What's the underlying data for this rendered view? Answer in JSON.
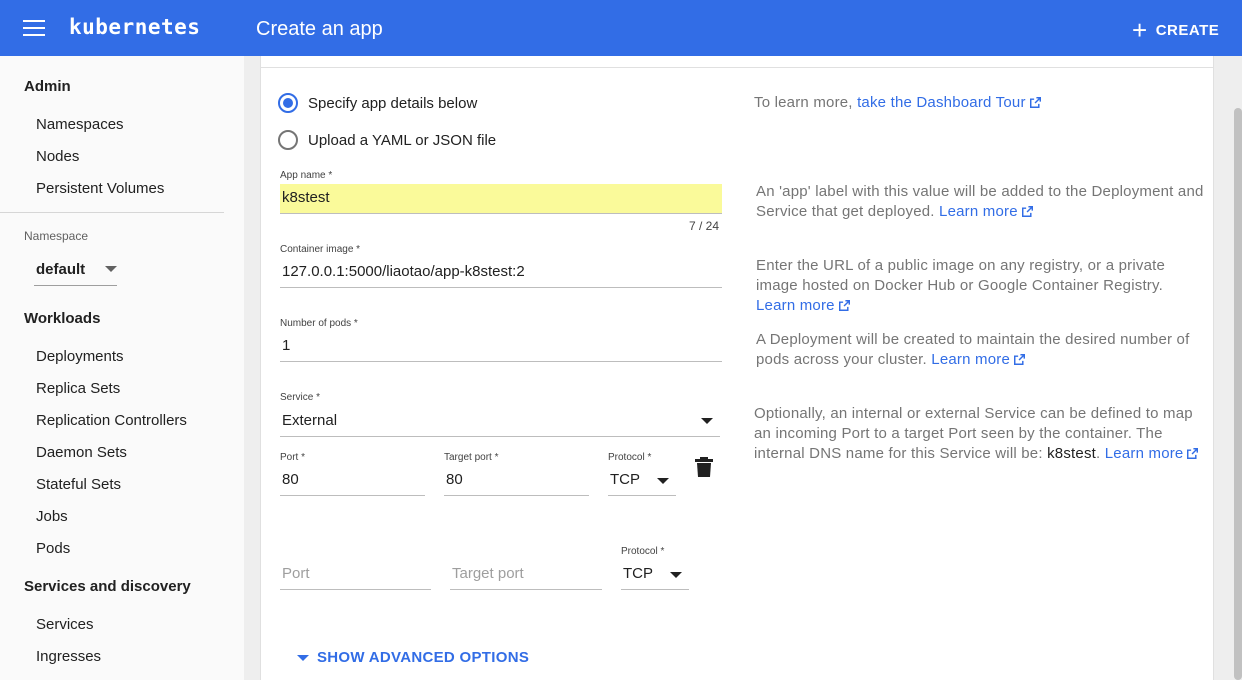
{
  "header": {
    "brand": "kubernetes",
    "title": "Create an app",
    "create_label": "CREATE"
  },
  "sidebar": {
    "admin_heading": "Admin",
    "admin_items": [
      "Namespaces",
      "Nodes",
      "Persistent Volumes"
    ],
    "namespace_label": "Namespace",
    "namespace_value": "default",
    "workloads_heading": "Workloads",
    "workload_items": [
      "Deployments",
      "Replica Sets",
      "Replication Controllers",
      "Daemon Sets",
      "Stateful Sets",
      "Jobs",
      "Pods"
    ],
    "services_heading": "Services and discovery",
    "service_items": [
      "Services",
      "Ingresses"
    ]
  },
  "form": {
    "radio_specify": "Specify app details below",
    "radio_upload": "Upload a YAML or JSON file",
    "app_name_label": "App name *",
    "app_name_value": "k8stest",
    "app_name_counter": "7 / 24",
    "container_image_label": "Container image *",
    "container_image_value": "127.0.0.1:5000/liaotao/app-k8stest:2",
    "pods_label": "Number of pods *",
    "pods_value": "1",
    "service_label": "Service *",
    "service_value": "External",
    "port_label": "Port *",
    "port_value": "80",
    "target_port_label": "Target port *",
    "target_port_value": "80",
    "protocol_label": "Protocol *",
    "protocol_value": "TCP",
    "port2_placeholder": "Port",
    "target_port2_placeholder": "Target port",
    "protocol2_label": "Protocol *",
    "protocol2_value": "TCP",
    "advanced_label": "SHOW ADVANCED OPTIONS"
  },
  "help": {
    "tour_prefix": "To learn more,",
    "tour_link": "take the Dashboard Tour",
    "app_name_text": "An 'app' label with this value will be added to the Deployment and Service that get deployed.",
    "image_text": "Enter the URL of a public image on any registry, or a private image hosted on Docker Hub or Google Container Registry.",
    "pods_text": "A Deployment will be created to maintain the desired number of pods across your cluster.",
    "service_text": "Optionally, an internal or external Service can be defined to map an incoming Port to a target Port seen by the container. The internal DNS name for this Service will be:",
    "service_name": "k8stest",
    "service_suffix": ".",
    "learn_more": "Learn more"
  },
  "colors": {
    "primary": "#326de6",
    "highlight": "#fafa9a"
  }
}
